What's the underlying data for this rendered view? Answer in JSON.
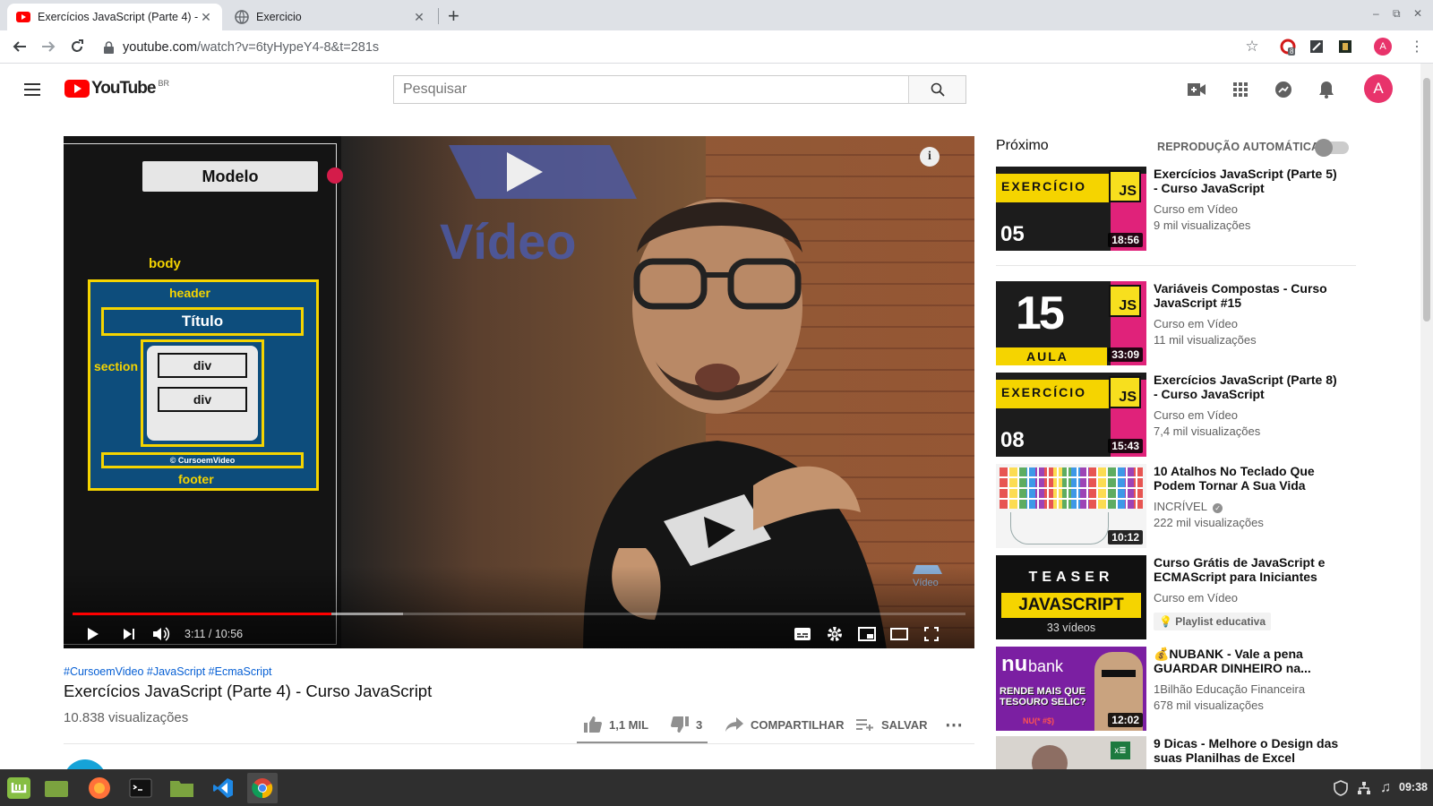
{
  "browser": {
    "tabs": [
      {
        "title": "Exercícios JavaScript (Parte 4) -",
        "active": true
      },
      {
        "title": "Exercicio",
        "active": false
      }
    ],
    "new_tab": "+",
    "url_host": "youtube.com",
    "url_rest": "/watch?v=6tyHypeY4-8&t=281s",
    "ext_badge": "8",
    "profile_initial": "A"
  },
  "youtube": {
    "logo_text": "YouTube",
    "region": "BR",
    "search_placeholder": "Pesquisar",
    "avatar_initial": "A"
  },
  "player": {
    "diagram": {
      "modelo": "Modelo",
      "body": "body",
      "header": "header",
      "titulo": "Título",
      "section": "section",
      "div1": "div",
      "div2": "div",
      "copyright": "© CursoemVideo",
      "footer": "footer"
    },
    "watermark": "Vídeo",
    "time": "3:11 / 10:56",
    "played_fraction": 0.29,
    "buffered_fraction": 0.37
  },
  "video": {
    "hashtags": "#CursoemVideo #JavaScript #EcmaScript",
    "title": "Exercícios JavaScript (Parte 4) - Curso JavaScript",
    "views": "10.838 visualizações",
    "likes": "1,1 MIL",
    "dislikes": "3",
    "share": "COMPARTILHAR",
    "save": "SALVAR"
  },
  "sidebar": {
    "up_next": "Próximo",
    "autoplay": "REPRODUÇÃO AUTOMÁTICA",
    "items": [
      {
        "title": "Exercícios JavaScript (Parte 5) - Curso JavaScript",
        "channel": "Curso em Vídeo",
        "views": "9 mil visualizações",
        "duration": "18:56",
        "thumb_top": "EXERCÍCIO",
        "thumb_num": "05",
        "thumb_js": "JS"
      },
      {
        "title": "Variáveis Compostas - Curso JavaScript #15",
        "channel": "Curso em Vídeo",
        "views": "11 mil visualizações",
        "duration": "33:09",
        "thumb_num": "15",
        "thumb_label": "AULA",
        "thumb_js": "JS"
      },
      {
        "title": "Exercícios JavaScript (Parte 8) - Curso JavaScript",
        "channel": "Curso em Vídeo",
        "views": "7,4 mil visualizações",
        "duration": "15:43",
        "thumb_top": "EXERCÍCIO",
        "thumb_num": "08",
        "thumb_js": "JS"
      },
      {
        "title": "10 Atalhos No Teclado Que Podem Tornar A Sua Vida Muit...",
        "channel": "INCRÍVEL",
        "views": "222 mil visualizações",
        "duration": "10:12"
      },
      {
        "title": "Curso Grátis de JavaScript e ECMAScript para Iniciantes",
        "channel": "Curso em Vídeo",
        "badge": "Playlist educativa",
        "thumb_top": "TEASER",
        "thumb_main": "JAVASCRIPT",
        "thumb_count": "33 vídeos"
      },
      {
        "title": "💰NUBANK - Vale a pena GUARDAR DINHEIRO na...",
        "channel": "1Bilhão Educação Financeira",
        "views": "678 mil visualizações",
        "duration": "12:02",
        "thumb_brand": "bank",
        "thumb_text": "RENDE MAIS QUE TESOURO SELIC?",
        "thumb_small": "NU(* #$)"
      },
      {
        "title": "9 Dicas - Melhore o Design das suas Planilhas de Excel",
        "thumb_badge": "x≣"
      }
    ]
  },
  "taskbar": {
    "clock": "09:38"
  }
}
